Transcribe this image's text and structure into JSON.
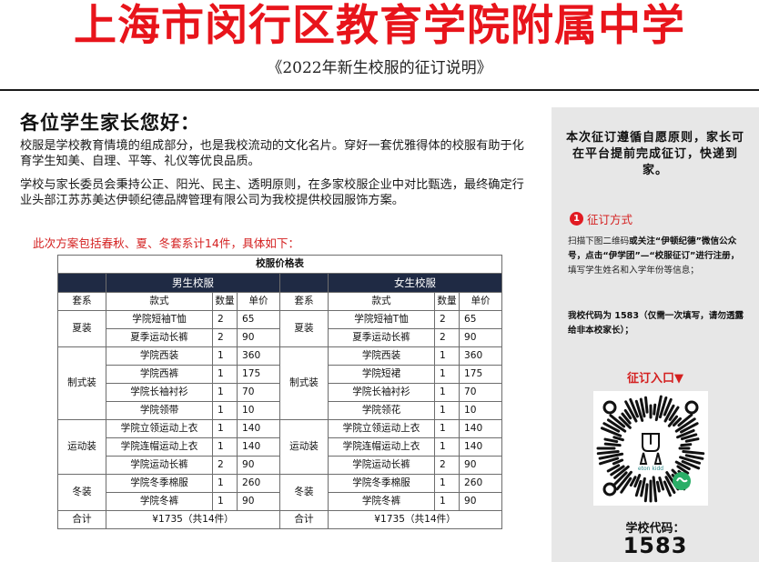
{
  "header": {
    "title": "上海市闵行区教育学院附属中学",
    "subtitle": "《2022年新生校服的征订说明》"
  },
  "body": {
    "greeting": "各位学生家长您好：",
    "paragraph1": "校服是学校教育情境的组成部分，也是我校流动的文化名片。穿好一套优雅得体的校服有助于化育学生知美、自理、平等、礼仪等优良品质。",
    "paragraph2": "学校与家长委员会秉持公正、阳光、民主、透明原则，在多家校服企业中对比甄选，最终确定行业头部江苏苏美达伊顿纪德品牌管理有限公司为我校提供校园服饰方案。",
    "plan_note": "此次方案包括春秋、夏、冬套系计14件，具体如下："
  },
  "price_table": {
    "caption": "校服价格表",
    "male_header": "男生校服",
    "female_header": "女生校服",
    "columns": [
      "套系",
      "款式",
      "数量",
      "单价",
      "套系",
      "款式",
      "数量",
      "单价"
    ],
    "rows": [
      [
        "夏装",
        "学院短袖T恤",
        "2",
        "65",
        "夏装",
        "学院短袖T恤",
        "2",
        "65"
      ],
      [
        "",
        "夏季运动长裤",
        "2",
        "90",
        "",
        "夏季运动长裤",
        "2",
        "90"
      ],
      [
        "制式装",
        "学院西装",
        "1",
        "360",
        "制式装",
        "学院西装",
        "1",
        "360"
      ],
      [
        "",
        "学院西裤",
        "1",
        "175",
        "",
        "学院短裙",
        "1",
        "175"
      ],
      [
        "",
        "学院长袖衬衫",
        "1",
        "70",
        "",
        "学院长袖衬衫",
        "1",
        "70"
      ],
      [
        "",
        "学院领带",
        "1",
        "10",
        "",
        "学院领花",
        "1",
        "10"
      ],
      [
        "运动装",
        "学院立领运动上衣",
        "1",
        "140",
        "运动装",
        "学院立领运动上衣",
        "1",
        "140"
      ],
      [
        "",
        "学院连帽运动上衣",
        "1",
        "140",
        "",
        "学院连帽运动上衣",
        "1",
        "140"
      ],
      [
        "",
        "学院运动长裤",
        "2",
        "90",
        "",
        "学院运动长裤",
        "2",
        "90"
      ],
      [
        "冬装",
        "学院冬季棉服",
        "1",
        "260",
        "冬装",
        "学院冬季棉服",
        "1",
        "260"
      ],
      [
        "",
        "学院冬裤",
        "1",
        "90",
        "",
        "学院冬裤",
        "1",
        "90"
      ]
    ],
    "total_label": "合计",
    "total_value": "¥1735（共14件）"
  },
  "panel": {
    "headline": "本次征订遵循自愿原则，家长可在平台提前完成征订，快递到家。",
    "method_number": "1",
    "method_label": "征订方式",
    "instr_part1": "扫描下图二维码",
    "instr_bold": "或关注“伊顿纪德”微信公众号，点击“伊学团”—“校服征订”进行注册，",
    "instr_part2": "填写学生姓名和入学年份等信息；",
    "code_note": "我校代码为 1583（仅需一次填写，请勿透露给非本校家长）；",
    "entry_label": "征订入口▼",
    "qr_brand": "eton kidd",
    "school_code_label": "学校代码：",
    "school_code": "1583"
  }
}
